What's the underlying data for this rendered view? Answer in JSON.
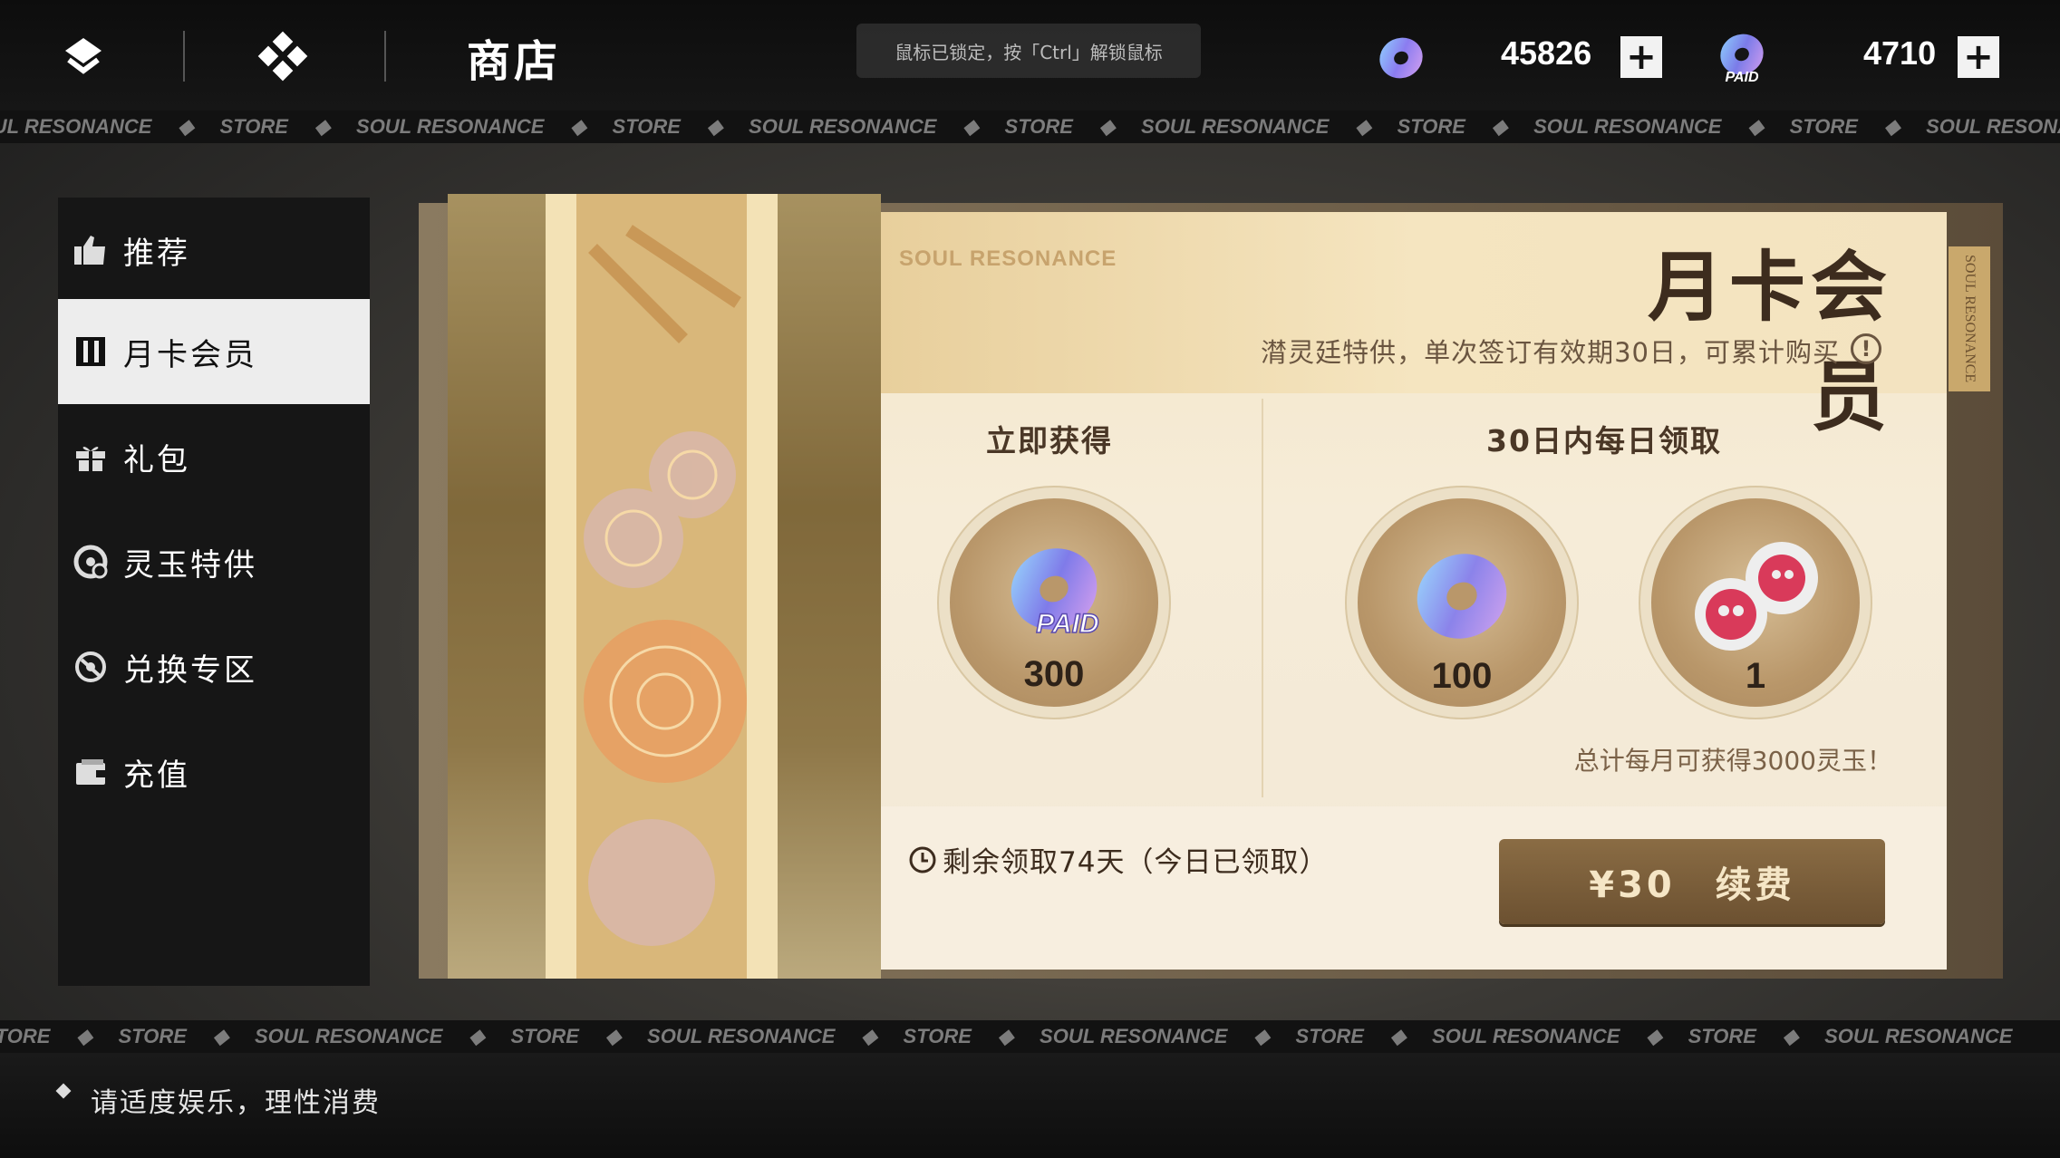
{
  "topbar": {
    "title": "商店",
    "lock_hint": "鼠标已锁定，按「Ctrl」解锁鼠标",
    "currency1_amount": "45826",
    "currency2_amount": "4710",
    "currency2_badge": "PAID",
    "plus_label": "+"
  },
  "marquee": {
    "brand": "SOUL RESONANCE",
    "store": "STORE",
    "sep": "◆"
  },
  "sidebar": {
    "items": [
      {
        "label": "推荐",
        "icon": "thumbs-up-icon"
      },
      {
        "label": "月卡会员",
        "icon": "card-icon",
        "active": true
      },
      {
        "label": "礼包",
        "icon": "gift-icon"
      },
      {
        "label": "灵玉特供",
        "icon": "jade-icon"
      },
      {
        "label": "兑换专区",
        "icon": "exchange-icon"
      },
      {
        "label": "充值",
        "icon": "wallet-icon"
      }
    ]
  },
  "card": {
    "brand": "SOUL RESONANCE",
    "title": "月卡会员",
    "description": "潸灵廷特供，单次签订有效期30日，可累计购买",
    "info": "!",
    "side_tag": "SOUL RESONANCE",
    "section_instant": "立即获得",
    "section_daily": "30日内每日领取",
    "rewards": [
      {
        "amount": "300",
        "badge": "PAID"
      },
      {
        "amount": "100"
      },
      {
        "amount": "1"
      }
    ],
    "total": "总计每月可获得3000灵玉！",
    "remaining": "剩余领取74天（今日已领取）",
    "buy_label": "¥30　续费"
  },
  "bottom_hint": "请适度娱乐，理性消费",
  "colors": {
    "accent_gold": "#6c5131",
    "card_bg": "#f6ecd8",
    "topbar_bg": "#0d0d0d"
  }
}
